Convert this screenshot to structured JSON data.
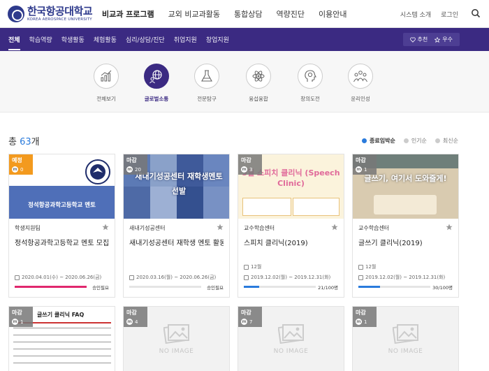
{
  "header": {
    "logo_kr": "한국항공대학교",
    "logo_en": "KOREA AEROSPACE UNIVERSITY",
    "nav": [
      "비교과 프로그램",
      "교외 비교과활동",
      "통합상담",
      "역량진단",
      "이용안내"
    ],
    "util": [
      "시스템 소개",
      "로그인"
    ]
  },
  "subnav": {
    "items": [
      "전체",
      "학습역량",
      "학생활동",
      "체험활동",
      "심리/상담/진단",
      "취업지원",
      "창업지원"
    ],
    "recommend": "추천",
    "excellent": "우수"
  },
  "categories": [
    {
      "label": "전체보기",
      "icon": "chart-growth-icon"
    },
    {
      "label": "글로벌소통",
      "icon": "globe-people-icon"
    },
    {
      "label": "전문탐구",
      "icon": "flask-icon"
    },
    {
      "label": "융섭융합",
      "icon": "atom-icon"
    },
    {
      "label": "창의도전",
      "icon": "head-brain-icon"
    },
    {
      "label": "윤리인성",
      "icon": "people-group-icon"
    }
  ],
  "total": {
    "prefix": "총 ",
    "count": "63",
    "suffix": "개"
  },
  "sort": [
    "종료임박순",
    "인기순",
    "최신순"
  ],
  "cards": [
    {
      "badge": "예정",
      "count": "0",
      "thumb_text": "정석항공과학고등학교 멘토",
      "category": "학생지원팀",
      "title": "정석항공과학고등학교 멘토 모집",
      "meta": "",
      "date": "2020.04.01(수) ~ 2020.06.26(금)",
      "status": "승인필요",
      "progress": 1.0
    },
    {
      "badge": "마감",
      "count": "20",
      "thumb_text": "새내기성공센터 재학생멘토선발",
      "category": "새내기성공센터",
      "title": "새내기성공센터 재학생 멘토 활동",
      "meta": "",
      "date": "2020.03.16(월) ~ 2020.06.26(금)",
      "status": "승인필요",
      "progress": 0.0
    },
    {
      "badge": "마감",
      "count": "3",
      "thumb_text": "3월 스피치 클리닉 (Speech Clinic)",
      "category": "교수학습센터",
      "title": "스피치 클리닉(2019)",
      "meta": "12월",
      "date": "2019.12.02(월) ~ 2019.12.31(화)",
      "status": "21/100명",
      "progress": 0.21
    },
    {
      "badge": "마감",
      "count": "1",
      "thumb_text": "글쓰기, 여기서 도와줄게!",
      "category": "교수학습센터",
      "title": "글쓰기 클리닉(2019)",
      "meta": "12월",
      "date": "2019.12.02(월) ~ 2019.12.31(화)",
      "status": "30/100명",
      "progress": 0.3
    },
    {
      "badge": "마감",
      "count": "1",
      "thumb_text": "글쓰기 클리닉 FAQ"
    },
    {
      "badge": "마감",
      "count": "4",
      "thumb_text": "NO IMAGE"
    },
    {
      "badge": "마감",
      "count": "7",
      "thumb_text": "NO IMAGE"
    },
    {
      "badge": "마감",
      "count": "1",
      "thumb_text": "NO IMAGE"
    }
  ]
}
